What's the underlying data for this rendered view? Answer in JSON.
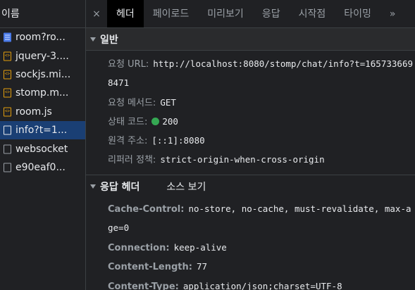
{
  "left_panel": {
    "header": "이름",
    "requests": [
      {
        "label": "room?ro...",
        "icon": "document-icon",
        "type": "doc",
        "selected": false
      },
      {
        "label": "jquery-3....",
        "icon": "script-icon",
        "type": "js",
        "selected": false
      },
      {
        "label": "sockjs.mi...",
        "icon": "script-icon",
        "type": "js",
        "selected": false
      },
      {
        "label": "stomp.m...",
        "icon": "script-icon",
        "type": "js",
        "selected": false
      },
      {
        "label": "room.js",
        "icon": "script-icon",
        "type": "js",
        "selected": false
      },
      {
        "label": "info?t=1...",
        "icon": "file-icon",
        "type": "plain",
        "selected": true
      },
      {
        "label": "websocket",
        "icon": "file-icon",
        "type": "plain",
        "selected": false
      },
      {
        "label": "e90eaf0...",
        "icon": "file-icon",
        "type": "plain",
        "selected": false
      }
    ]
  },
  "tabs": {
    "close": "×",
    "items": [
      {
        "label": "헤더",
        "active": true
      },
      {
        "label": "페이로드",
        "active": false
      },
      {
        "label": "미리보기",
        "active": false
      },
      {
        "label": "응답",
        "active": false
      },
      {
        "label": "시작점",
        "active": false
      },
      {
        "label": "타이밍",
        "active": false
      }
    ],
    "overflow": "»"
  },
  "general": {
    "title": "일반",
    "request_url_key": "요청 URL:",
    "request_url": "http://localhost:8080/stomp/chat/info?t=1657336698471",
    "method_key": "요청 메서드:",
    "method": "GET",
    "status_key": "상태 코드:",
    "status": "200",
    "status_color": "#35a853",
    "remote_key": "원격 주소:",
    "remote": "[::1]:8080",
    "referrer_key": "리퍼러 정책:",
    "referrer": "strict-origin-when-cross-origin"
  },
  "response_headers": {
    "title": "응답 헤더",
    "view_source": "소스 보기",
    "items": [
      {
        "key": "Cache-Control:",
        "value": "no-store, no-cache, must-revalidate, max-age=0"
      },
      {
        "key": "Connection:",
        "value": "keep-alive"
      },
      {
        "key": "Content-Length:",
        "value": "77"
      },
      {
        "key": "Content-Type:",
        "value": "application/json;charset=UTF-8"
      }
    ]
  },
  "colors": {
    "background": "#202124",
    "selected_row": "#1a3f74",
    "active_tab": "#000000",
    "js_icon": "#e5a00d",
    "doc_icon": "#4a7ae8"
  }
}
